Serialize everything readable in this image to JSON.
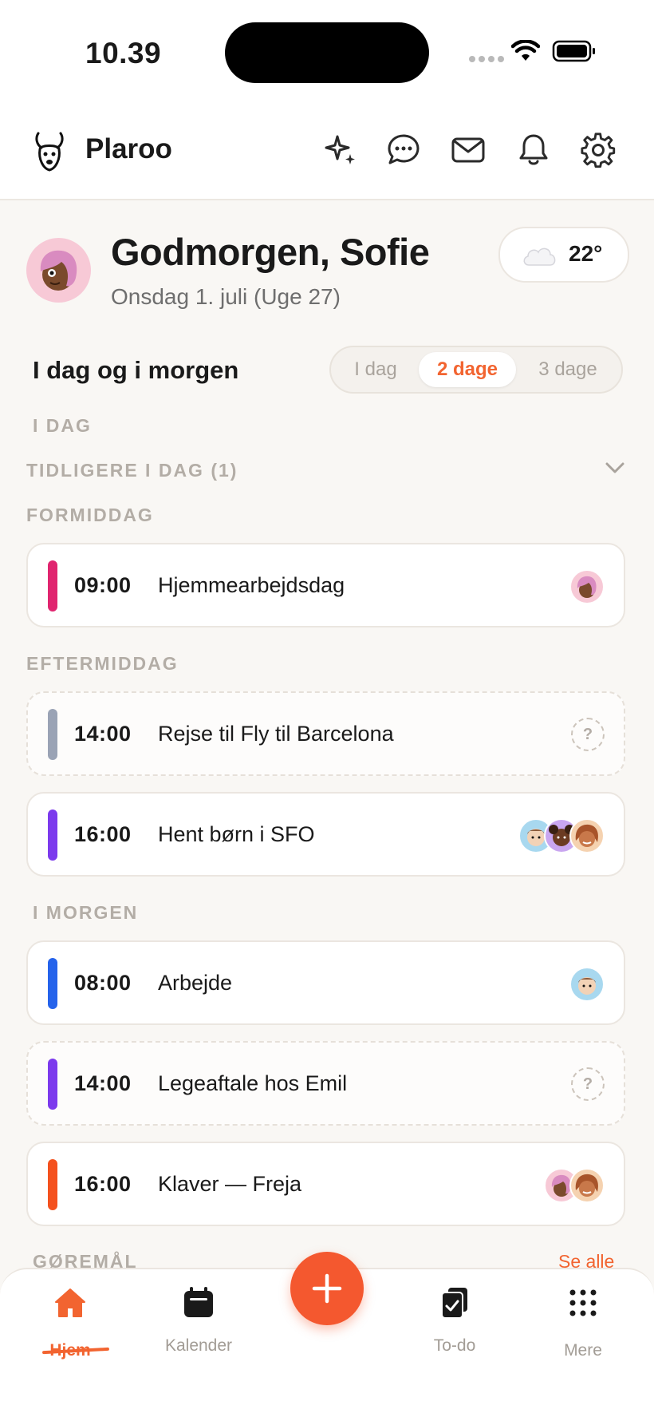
{
  "status_bar": {
    "time": "10.39"
  },
  "header": {
    "brand": "Plaroo"
  },
  "greeting": {
    "title": "Godmorgen, Sofie",
    "date": "Onsdag 1. juli (Uge 27)"
  },
  "weather": {
    "temp": "22°"
  },
  "section": {
    "title": "I dag og i morgen",
    "range_options": [
      "I dag",
      "2 dage",
      "3 dage"
    ],
    "selected_range": "2 dage"
  },
  "labels": {
    "today": "I DAG",
    "earlier_today": "TIDLIGERE I DAG (1)",
    "morning": "FORMIDDAG",
    "afternoon": "EFTERMIDDAG",
    "tomorrow": "I MORGEN"
  },
  "events": [
    {
      "time": "09:00",
      "title": "Hjemmearbejdsdag",
      "color": "#e0256f"
    },
    {
      "time": "14:00",
      "title": "Rejse til Fly til Barcelona",
      "color": "#9aa3b5",
      "unassigned": true
    },
    {
      "time": "16:00",
      "title": "Hent børn i SFO",
      "color": "#7c3aed"
    },
    {
      "time": "08:00",
      "title": "Arbejde",
      "color": "#2563eb"
    },
    {
      "time": "14:00",
      "title": "Legeaftale hos Emil",
      "color": "#7c3aed",
      "unassigned": true
    },
    {
      "time": "16:00",
      "title": "Klaver — Freja",
      "color": "#f4511e"
    }
  ],
  "unknown_marker": "?",
  "todos": {
    "title": "GØREMÅL",
    "see_all": "Se alle"
  },
  "tabbar": {
    "items": [
      {
        "label": "Hjem",
        "icon": "home-icon"
      },
      {
        "label": "Kalender",
        "icon": "calendar-icon"
      },
      {
        "label": "To-do",
        "icon": "todo-icon"
      },
      {
        "label": "Mere",
        "icon": "grid-icon"
      }
    ]
  },
  "colors": {
    "accent": "#f26430",
    "background": "#f9f7f4"
  }
}
